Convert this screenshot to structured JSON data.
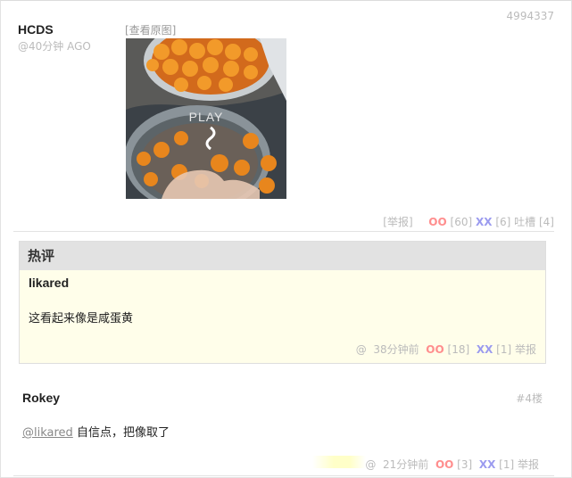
{
  "post": {
    "id": "4994337",
    "author": "HCDS",
    "time": "@40分钟 AGO",
    "view_original": "[查看原图]",
    "play_label": "PLAY",
    "report": "[举报]",
    "oo_label": "OO",
    "oo_count": "[60]",
    "xx_label": "XX",
    "xx_count": "[6]",
    "tucao": "吐槽 [4]"
  },
  "hot_comment": {
    "section_title": "热评",
    "user": "likared",
    "text": "这看起来像是咸蛋黄",
    "at": "@",
    "time": "38分钟前",
    "oo_label": "OO",
    "oo_count": "[18]",
    "xx_label": "XX",
    "xx_count": "[1]",
    "report": "举报"
  },
  "comment": {
    "user": "Rokey",
    "floor": "#4楼",
    "mention": "@likared",
    "text": " 自信点，把像取了",
    "at": "@",
    "time": "21分钟前",
    "oo_label": "OO",
    "oo_count": "[3]",
    "xx_label": "XX",
    "xx_count": "[1]",
    "report": "举报"
  },
  "colors": {
    "oo": "#ff8e8e",
    "xx": "#9b9bef",
    "hot_bg": "#fffeea",
    "hot_header_bg": "#e2e2e2"
  }
}
